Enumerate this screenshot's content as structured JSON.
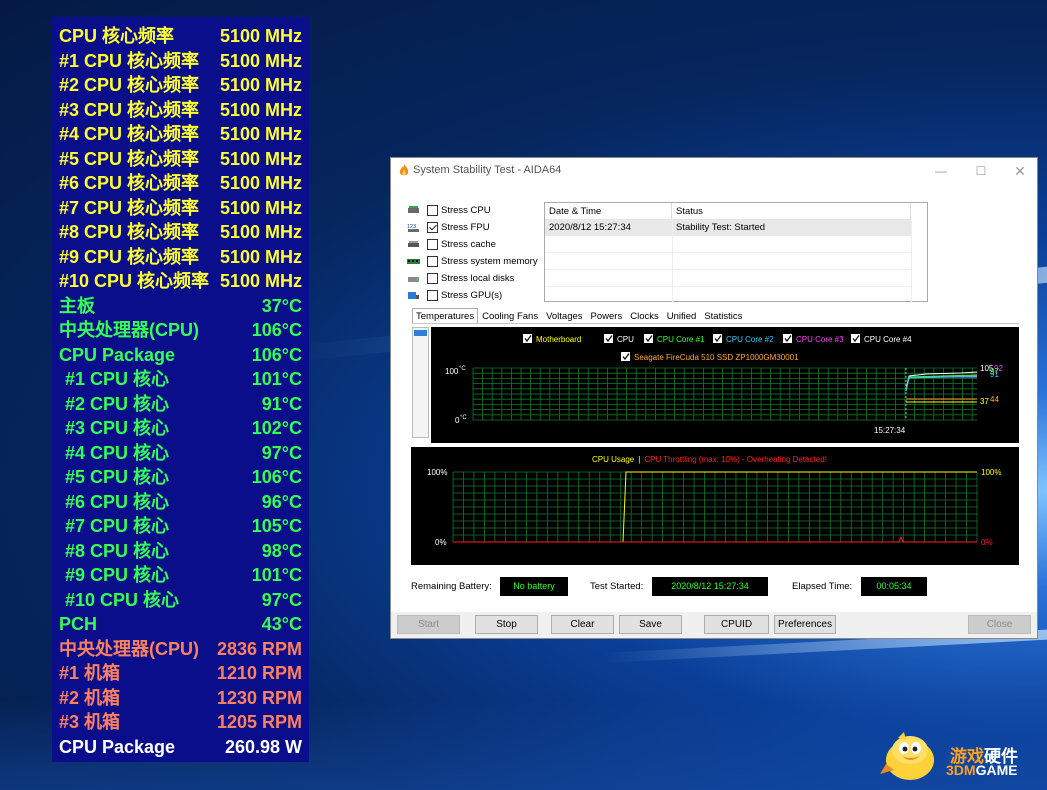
{
  "osd": {
    "rows": [
      {
        "label": "CPU 核心频率",
        "value": "5100 MHz",
        "color": "yellow"
      },
      {
        "label": "#1 CPU 核心频率",
        "value": "5100 MHz",
        "color": "yellow"
      },
      {
        "label": "#2 CPU 核心频率",
        "value": "5100 MHz",
        "color": "yellow"
      },
      {
        "label": "#3 CPU 核心频率",
        "value": "5100 MHz",
        "color": "yellow"
      },
      {
        "label": "#4 CPU 核心频率",
        "value": "5100 MHz",
        "color": "yellow"
      },
      {
        "label": "#5 CPU 核心频率",
        "value": "5100 MHz",
        "color": "yellow"
      },
      {
        "label": "#6 CPU 核心频率",
        "value": "5100 MHz",
        "color": "yellow"
      },
      {
        "label": "#7 CPU 核心频率",
        "value": "5100 MHz",
        "color": "yellow"
      },
      {
        "label": "#8 CPU 核心频率",
        "value": "5100 MHz",
        "color": "yellow"
      },
      {
        "label": "#9 CPU 核心频率",
        "value": "5100 MHz",
        "color": "yellow"
      },
      {
        "label": "#10 CPU 核心频率",
        "value": "5100 MHz",
        "color": "yellow"
      },
      {
        "label": "主板",
        "value": "37°C",
        "color": "green"
      },
      {
        "label": "中央处理器(CPU)",
        "value": "106°C",
        "color": "green"
      },
      {
        "label": "CPU Package",
        "value": "106°C",
        "color": "green"
      },
      {
        "label": "#1 CPU 核心",
        "value": "101°C",
        "color": "green",
        "indent": true
      },
      {
        "label": "#2 CPU 核心",
        "value": "91°C",
        "color": "green",
        "indent": true
      },
      {
        "label": "#3 CPU 核心",
        "value": "102°C",
        "color": "green",
        "indent": true
      },
      {
        "label": "#4 CPU 核心",
        "value": "97°C",
        "color": "green",
        "indent": true
      },
      {
        "label": "#5 CPU 核心",
        "value": "106°C",
        "color": "green",
        "indent": true
      },
      {
        "label": "#6 CPU 核心",
        "value": "96°C",
        "color": "green",
        "indent": true
      },
      {
        "label": "#7 CPU 核心",
        "value": "105°C",
        "color": "green",
        "indent": true
      },
      {
        "label": "#8 CPU 核心",
        "value": "98°C",
        "color": "green",
        "indent": true
      },
      {
        "label": "#9 CPU 核心",
        "value": "101°C",
        "color": "green",
        "indent": true
      },
      {
        "label": "#10 CPU 核心",
        "value": "97°C",
        "color": "green",
        "indent": true
      },
      {
        "label": "PCH",
        "value": "43°C",
        "color": "green"
      },
      {
        "label": "中央处理器(CPU)",
        "value": "2836 RPM",
        "color": "salmon"
      },
      {
        "label": "#1 机箱",
        "value": "1210 RPM",
        "color": "salmon"
      },
      {
        "label": "#2 机箱",
        "value": "1230 RPM",
        "color": "salmon"
      },
      {
        "label": "#3 机箱",
        "value": "1205 RPM",
        "color": "salmon"
      },
      {
        "label": "CPU Package",
        "value": "260.98 W",
        "color": "white"
      }
    ]
  },
  "window": {
    "title": "System Stability Test - AIDA64",
    "min_glyph": "—",
    "max_glyph": "☐",
    "close_glyph": "✕",
    "stress_options": [
      {
        "label": "Stress CPU",
        "checked": false,
        "icon": "cpu-chip-icon"
      },
      {
        "label": "Stress FPU",
        "checked": true,
        "icon": "fpu-123-icon"
      },
      {
        "label": "Stress cache",
        "checked": false,
        "icon": "cache-icon"
      },
      {
        "label": "Stress system memory",
        "checked": false,
        "icon": "memory-module-icon"
      },
      {
        "label": "Stress local disks",
        "checked": false,
        "icon": "disk-drive-icon"
      },
      {
        "label": "Stress GPU(s)",
        "checked": false,
        "icon": "gpu-card-icon"
      }
    ],
    "fpu_icon_text": "123",
    "status_table": {
      "headers": [
        "Date & Time",
        "Status"
      ],
      "rows": [
        [
          "2020/8/12 15:27:34",
          "Stability Test: Started"
        ]
      ]
    },
    "tabs": [
      "Temperatures",
      "Cooling Fans",
      "Voltages",
      "Powers",
      "Clocks",
      "Unified",
      "Statistics"
    ],
    "active_tab": "Temperatures",
    "temp_legend": [
      {
        "label": "Motherboard",
        "color": "#ffff00"
      },
      {
        "label": "CPU",
        "color": "#ffffff"
      },
      {
        "label": "CPU Core #1",
        "color": "#33ff33"
      },
      {
        "label": "CPU Core #2",
        "color": "#33ccff"
      },
      {
        "label": "CPU Core #3",
        "color": "#ff44ff"
      },
      {
        "label": "CPU Core #4",
        "color": "#ffffff"
      },
      {
        "label": "Seagate FireCuda 510 SSD ZP1000GM30001",
        "color": "#ffaa33"
      }
    ],
    "temp_axis": {
      "top": "100",
      "bottom": "0",
      "unit": "°C",
      "time_label": "15:27:34"
    },
    "temp_end_labels": [
      {
        "text": "105",
        "color": "#ffffff"
      },
      {
        "text": "92",
        "color": "#ff44ff"
      },
      {
        "text": "97",
        "color": "#33ff33"
      },
      {
        "text": "91",
        "color": "#33ccff"
      },
      {
        "text": "37",
        "color": "#ffff00"
      },
      {
        "text": "44",
        "color": "#ffaa33"
      }
    ],
    "usage_header": {
      "left": "CPU Usage",
      "sep": "|",
      "right": "CPU Throttling (max: 10%) - Overheating Detected!",
      "left_color": "#ffff00",
      "right_color": "#ff2020"
    },
    "usage_axis": {
      "top": "100%",
      "bottom": "0%",
      "right_top": "100%",
      "right_bottom": "0%"
    },
    "info": {
      "battery_label": "Remaining Battery:",
      "battery_value": "No battery",
      "started_label": "Test Started:",
      "started_value": "2020/8/12 15:27:34",
      "elapsed_label": "Elapsed Time:",
      "elapsed_value": "00:05:34"
    },
    "buttons": [
      {
        "label": "Start",
        "enabled": false
      },
      {
        "label": "Stop",
        "enabled": true
      },
      {
        "label": "Clear",
        "enabled": true
      },
      {
        "label": "Save",
        "enabled": true
      },
      {
        "label": "CPUID",
        "enabled": true
      },
      {
        "label": "Preferences",
        "enabled": true
      },
      {
        "label": "Close",
        "enabled": false
      }
    ]
  },
  "watermark": {
    "cn_a": "游戏",
    "cn_b": "硬件",
    "en_a": "3DM",
    "en_b": "GAME"
  }
}
